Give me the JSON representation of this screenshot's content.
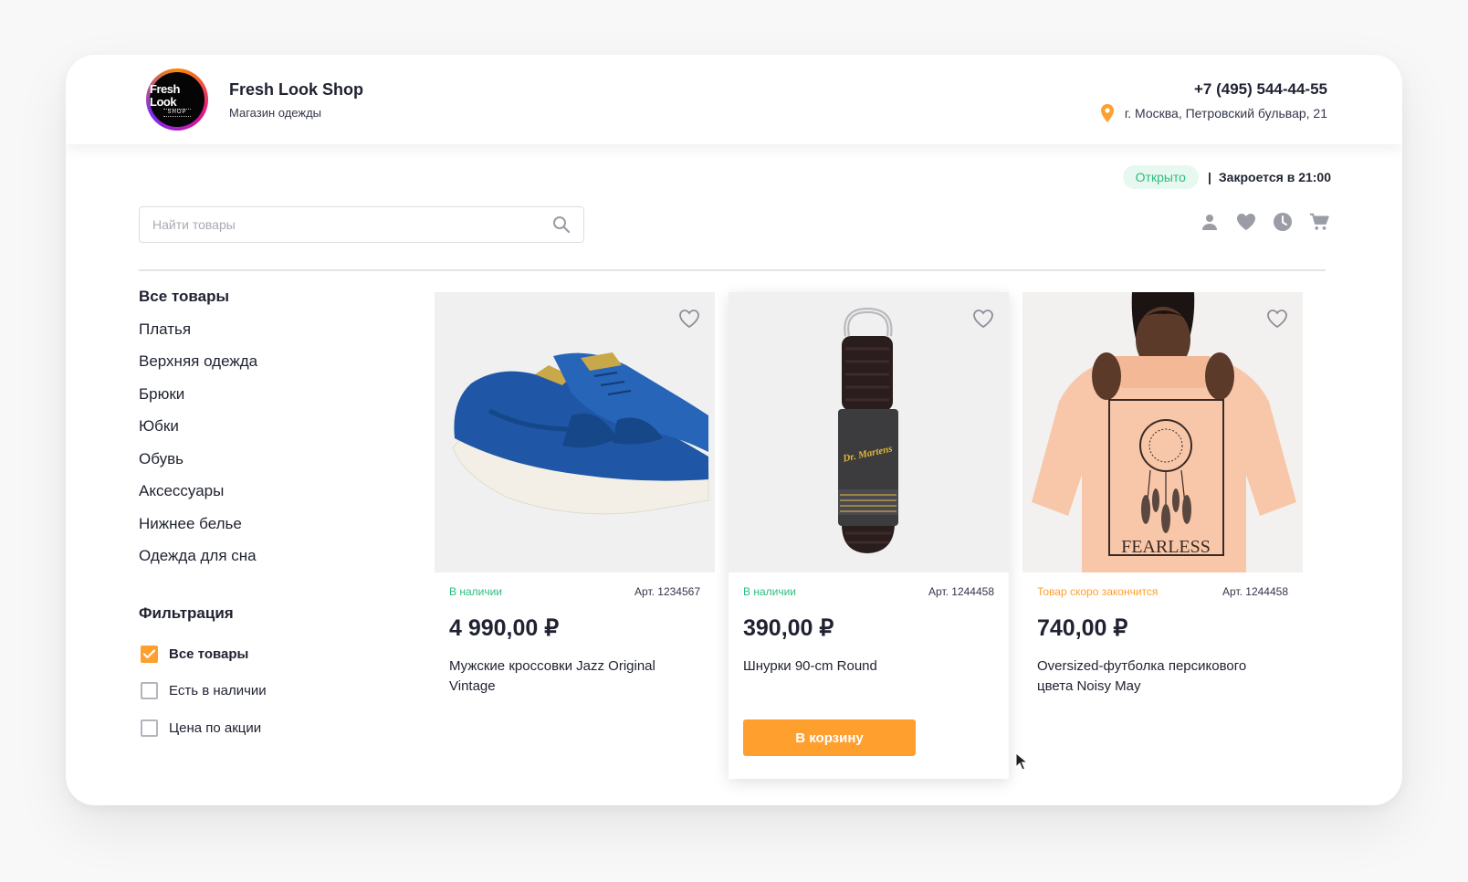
{
  "header": {
    "logo_main": "Fresh Look",
    "logo_sub": "SHOP",
    "shop_name": "Fresh Look Shop",
    "shop_subtitle": "Магазин одежды",
    "phone": "+7 (495) 544-44-55",
    "address": "г. Москва, Петровский бульвар, 21",
    "accent_color": "#ff9f2e"
  },
  "status": {
    "badge": "Открыто",
    "separator": "|",
    "closes": "Закроется в 21:00",
    "badge_color": "#2bbd7e"
  },
  "search": {
    "placeholder": "Найти товары",
    "value": ""
  },
  "toolbar_icons": [
    "user-icon",
    "heart-icon",
    "clock-icon",
    "cart-icon"
  ],
  "sidebar": {
    "categories": [
      {
        "label": "Все товары",
        "active": true
      },
      {
        "label": "Платья"
      },
      {
        "label": "Верхняя одежда"
      },
      {
        "label": "Брюки"
      },
      {
        "label": "Юбки"
      },
      {
        "label": "Обувь"
      },
      {
        "label": "Аксессуары"
      },
      {
        "label": "Нижнее белье"
      },
      {
        "label": "Одежда для сна"
      }
    ],
    "filter_title": "Фильтрация",
    "filters": [
      {
        "label": "Все товары",
        "checked": true
      },
      {
        "label": "Есть в наличии",
        "checked": false
      },
      {
        "label": "Цена по акции",
        "checked": false
      }
    ]
  },
  "products": [
    {
      "stock": "В наличии",
      "article": "Арт. 1234567",
      "price": "4 990,00 ₽",
      "name": "Мужские кроссовки Jazz Original Vintage",
      "image": "blue-sneaker"
    },
    {
      "stock": "В наличии",
      "article": "Арт. 1244458",
      "price": "390,00 ₽",
      "name": "Шнурки 90-cm Round",
      "image": "shoelaces",
      "cart_button": "В корзину"
    },
    {
      "stock": "Товар скоро закончится",
      "article": "Арт. 1244458",
      "price": "740,00 ₽",
      "name": "Oversized-футболка персикового цвета Noisy May",
      "image": "peach-tshirt",
      "print_text": "FEARLESS"
    }
  ],
  "laces_brand": "Dr. Martens"
}
